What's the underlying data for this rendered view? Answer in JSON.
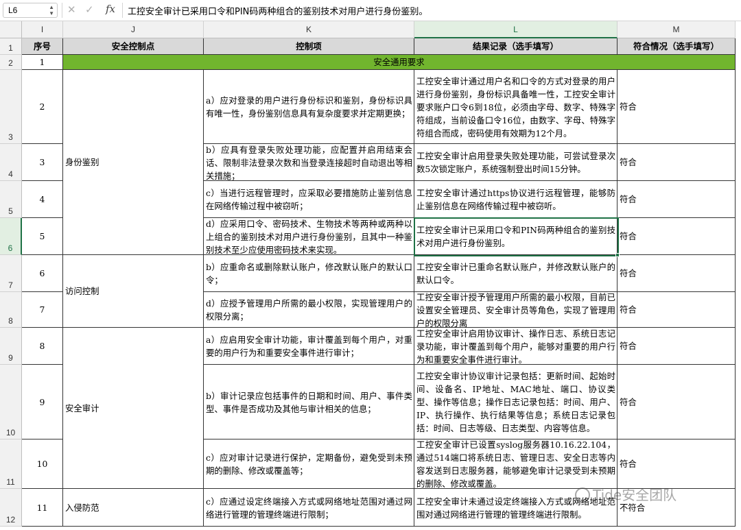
{
  "formula_bar": {
    "cell_ref": "L6",
    "fx": "fx",
    "formula": "工控安全审计已采用口令和PIN码两种组合的鉴别技术对用户进行身份鉴别。"
  },
  "columns": [
    "I",
    "J",
    "K",
    "L",
    "M"
  ],
  "row_numbers": [
    "1",
    "2",
    "3",
    "4",
    "5",
    "6",
    "7",
    "8",
    "9",
    "10",
    "11",
    "12"
  ],
  "headers": {
    "seq": "序号",
    "control_point": "安全控制点",
    "control_item": "控制项",
    "result": "结果记录（选手填写）",
    "compliance": "符合情况（选手填写）"
  },
  "section": {
    "seq": "1",
    "title": "安全通用要求"
  },
  "groups": [
    "身份鉴别",
    "访问控制",
    "安全审计",
    "入侵防范"
  ],
  "rows": [
    {
      "seq": "2",
      "item": "a）应对登录的用户进行身份标识和鉴别，身份标识具有唯一性，身份鉴别信息具有复杂度要求并定期更换；",
      "result": "工控安全审计通过用户名和口令的方式对登录的用户进行身份鉴别，身份标识具备唯一性，工控安全审计要求账户口令6到18位，必须由字母、数字、特殊字符组成，当前设备口令16位，由数字、字母、特殊字符组合而成，密码使用有效期为12个月。",
      "compliance": "符合"
    },
    {
      "seq": "3",
      "item": "b）应具有登录失败处理功能，应配置并启用结束会话、限制非法登录次数和当登录连接超时自动退出等相关措施；",
      "result": "工控安全审计启用登录失败处理功能，可尝试登录次数5次锁定账户，系统强制登出时间15分钟。",
      "compliance": "符合"
    },
    {
      "seq": "4",
      "item": "c）当进行远程管理时，应采取必要措施防止鉴别信息在网络传输过程中被窃听；",
      "result": "工控安全审计通过https协议进行远程管理，能够防止鉴别信息在网络传输过程中被窃听。",
      "compliance": "符合"
    },
    {
      "seq": "5",
      "item": "d）应采用口令、密码技术、生物技术等两种或两种以上组合的鉴别技术对用户进行身份鉴别，且其中一种鉴别技术至少应使用密码技术来实现。",
      "result": "工控安全审计已采用口令和PIN码两种组合的鉴别技术对用户进行身份鉴别。",
      "compliance": "符合"
    },
    {
      "seq": "6",
      "item": "b）应重命名或删除默认账户，修改默认账户的默认口令；",
      "result": "工控安全审计已重命名默认账户，并修改默认账户的默认口令。",
      "compliance": "符合"
    },
    {
      "seq": "7",
      "item": "d）应授予管理用户所需的最小权限，实现管理用户的权限分离；",
      "result": "工控安全审计授予管理用户所需的最小权限，目前已设置安全管理员、安全审计员等角色，实现了管理用户的权限分离",
      "compliance": "符合"
    },
    {
      "seq": "8",
      "item": "a）应启用安全审计功能，审计覆盖到每个用户，对重要的用户行为和重要安全事件进行审计；",
      "result": "工控安全审计启用协议审计、操作日志、系统日志记录功能，审计覆盖到每个用户，能够对重要的用户行为和重要安全事件进行审计。",
      "compliance": "符合"
    },
    {
      "seq": "9",
      "item": "b）审计记录应包括事件的日期和时间、用户、事件类型、事件是否成功及其他与审计相关的信息；",
      "result": "工控安全审计协议审计记录包括：更新时间、起始时间、设备名、IP地址、MAC地址、端口、协议类型、操作等信息；操作日志记录包括：时间、用户、IP、执行操作、执行结果等信息；系统日志记录包括：时间、日志等级、日志类型、内容等信息。",
      "compliance": "符合"
    },
    {
      "seq": "10",
      "item": "c）应对审计记录进行保护，定期备份，避免受到未预期的删除、修改或覆盖等；",
      "result": "工控安全审计已设置syslog服务器10.16.22.104，通过514端口将系统日志、管理日志、安全日志等内容发送到日志服务器，能够避免审计记录受到未预期的删除、修改或覆盖。",
      "compliance": "符合"
    },
    {
      "seq": "11",
      "item": "c）应通过设定终端接入方式或网络地址范围对通过网络进行管理的管理终端进行限制；",
      "result": "工控安全审计未通过设定终端接入方式或网络地址范围对通过网络进行管理的管理终端进行限制。",
      "compliance": "不符合"
    }
  ],
  "watermark": "Tide安全团队",
  "colors": {
    "section_green": "#71b52e",
    "header_gray": "#d9d9d9",
    "selection_green": "#1e7145"
  }
}
